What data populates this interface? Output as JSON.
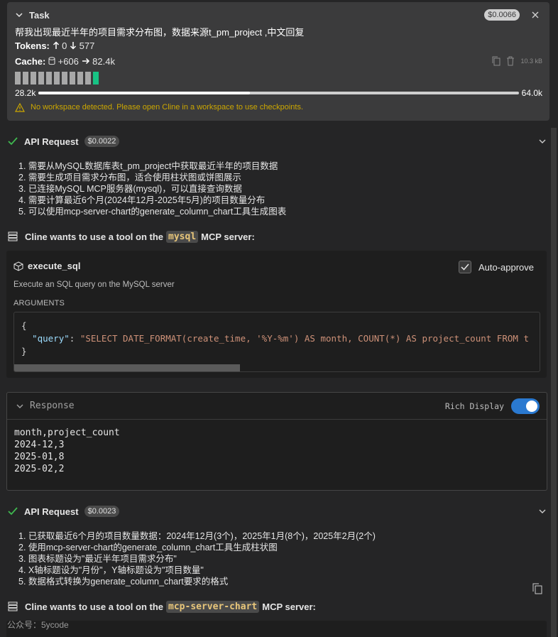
{
  "task": {
    "title": "Task",
    "cost": "$0.0066",
    "text": "帮我出现最近半年的项目需求分布图，数据来源t_pm_project ,中文回复",
    "tokens_label": "Tokens:",
    "tokens_up": "0",
    "tokens_down": "577",
    "cache_label": "Cache:",
    "cache_write": "+606",
    "cache_read": "82.4k",
    "size": "10.3 kB",
    "context_used": "28.2k",
    "context_max": "64.0k",
    "context_fraction": 0.44,
    "warning": "No workspace detected. Please open Cline in a workspace to use checkpoints."
  },
  "api1": {
    "title": "API Request",
    "cost": "$0.0022",
    "steps": [
      "1. 需要从MySQL数据库表t_pm_project中获取最近半年的项目数据",
      "2. 需要生成项目需求分布图，适合使用柱状图或饼图展示",
      "3. 已连接MySQL MCP服务器(mysql)，可以直接查询数据",
      "4. 需要计算最近6个月(2024年12月-2025年5月)的项目数量分布",
      "5. 可以使用mcp-server-chart的generate_column_chart工具生成图表"
    ]
  },
  "tool1": {
    "prefix": "Cline wants to use a tool on the",
    "server": "mysql",
    "suffix": "MCP server:",
    "name": "execute_sql",
    "auto_approve": "Auto-approve",
    "description": "Execute an SQL query on the MySQL server",
    "args_label": "ARGUMENTS",
    "code_key": "\"query\"",
    "code_value": "\"SELECT DATE_FORMAT(create_time, '%Y-%m') AS month, COUNT(*) AS project_count FROM t"
  },
  "response": {
    "label": "Response",
    "rich_display": "Rich Display",
    "lines": [
      "month,project_count",
      "2024-12,3",
      "2025-01,8",
      "2025-02,2"
    ]
  },
  "api2": {
    "title": "API Request",
    "cost": "$0.0023",
    "steps": [
      "1. 已获取最近6个月的项目数量数据：2024年12月(3个)，2025年1月(8个)，2025年2月(2个)",
      "2. 使用mcp-server-chart的generate_column_chart工具生成柱状图",
      "3. 图表标题设为\"最近半年项目需求分布\"",
      "4. X轴标题设为\"月份\"，Y轴标题设为\"项目数量\"",
      "5. 数据格式转换为generate_column_chart要求的格式"
    ]
  },
  "tool2": {
    "prefix": "Cline wants to use a tool on the",
    "server": "mcp-server-chart",
    "suffix": "MCP server:"
  },
  "watermark": "公众号：5ycode",
  "colors": {
    "accent_green": "#17c284",
    "warning": "#cca700",
    "toggle": "#2a79d0",
    "server_chip": "#e8c67a"
  }
}
